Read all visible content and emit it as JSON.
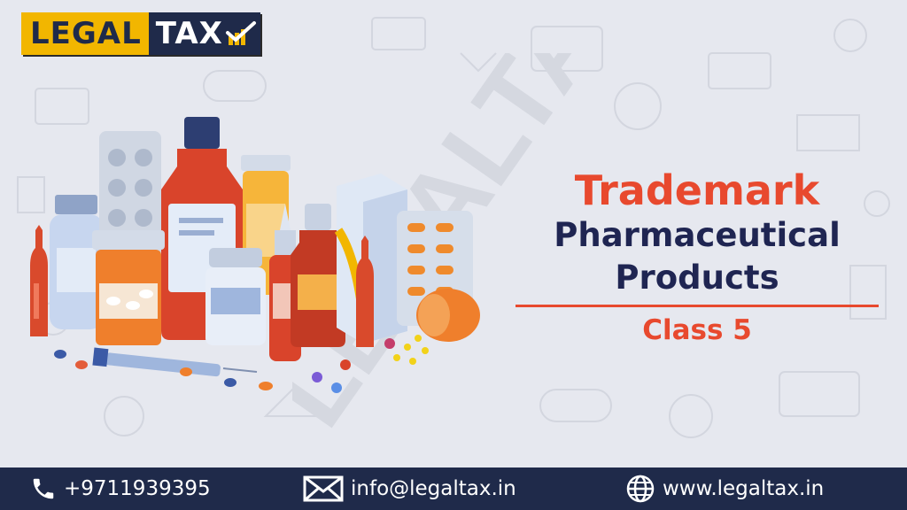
{
  "logo": {
    "part1": "LEGAL",
    "part2": "TAX"
  },
  "heading": {
    "line1": "Trademark",
    "line2": "Pharmaceutical",
    "line3": "Products",
    "line4": "Class 5"
  },
  "watermark": "LEGALTAX",
  "footer": {
    "phone": "+9711939395",
    "email": "info@legaltax.in",
    "website": "www.legaltax.in"
  },
  "colors": {
    "navy": "#1f2a4a",
    "accent": "#e8492e",
    "logo_yellow": "#f2b600",
    "background": "#e6e8ef"
  },
  "icons": [
    "phone-icon",
    "envelope-icon",
    "globe-icon",
    "check-chart-icon"
  ]
}
